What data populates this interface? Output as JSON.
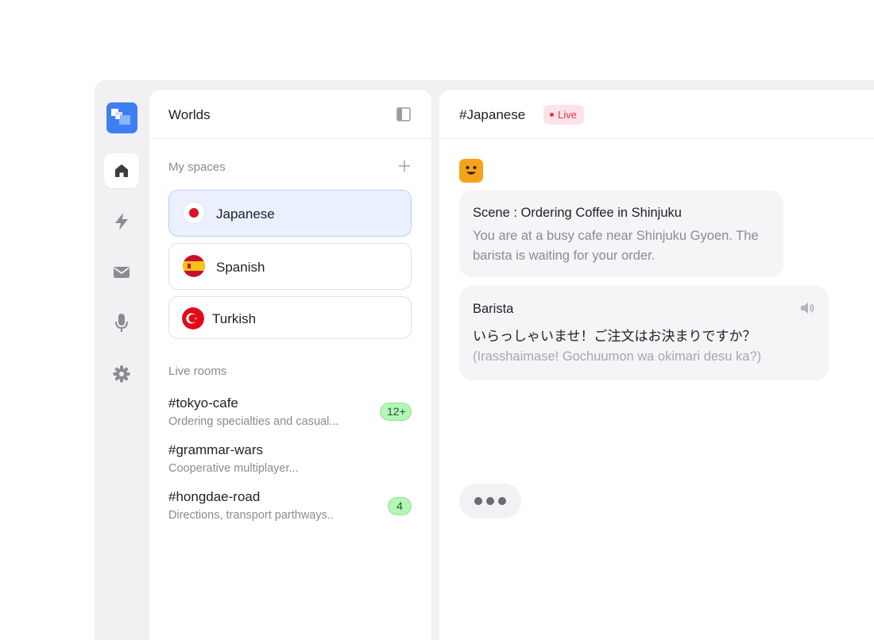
{
  "sidebar": {
    "title": "Worlds",
    "my_spaces_label": "My spaces",
    "spaces": [
      {
        "label": "Japanese",
        "selected": true
      },
      {
        "label": "Spanish",
        "selected": false
      },
      {
        "label": "Turkish",
        "selected": false
      }
    ],
    "live_rooms_label": "Live rooms",
    "rooms": [
      {
        "name": "#tokyo-cafe",
        "desc": "Ordering specialties and casual...",
        "badge": "12+"
      },
      {
        "name": "#grammar-wars",
        "desc": "Cooperative multiplayer...",
        "badge": ""
      },
      {
        "name": "#hongdae-road",
        "desc": "Directions, transport parthways..",
        "badge": "4"
      }
    ]
  },
  "rail": {
    "icons": [
      "home-icon",
      "bolt-icon",
      "mail-icon",
      "mic-icon",
      "gear-icon"
    ],
    "active": "home-icon"
  },
  "chat": {
    "title": "#Japanese",
    "live_label": "Live",
    "scene": {
      "title": "Scene : Ordering Coffee in Shinjuku",
      "desc": "You are at a busy cafe near Shinjuku Gyoen. The barista is waiting for your order."
    },
    "message": {
      "speaker": "Barista",
      "japanese": "いらっしゃいませ！ご注文はお決まりですか？",
      "romaji": "(Irasshaimase! Gochuumon wa okimari desu ka?)"
    }
  },
  "colors": {
    "accent": "#3d7ff2",
    "live": "#e0304c",
    "badge": "#b4f5b8",
    "avatar": "#f5a319"
  }
}
